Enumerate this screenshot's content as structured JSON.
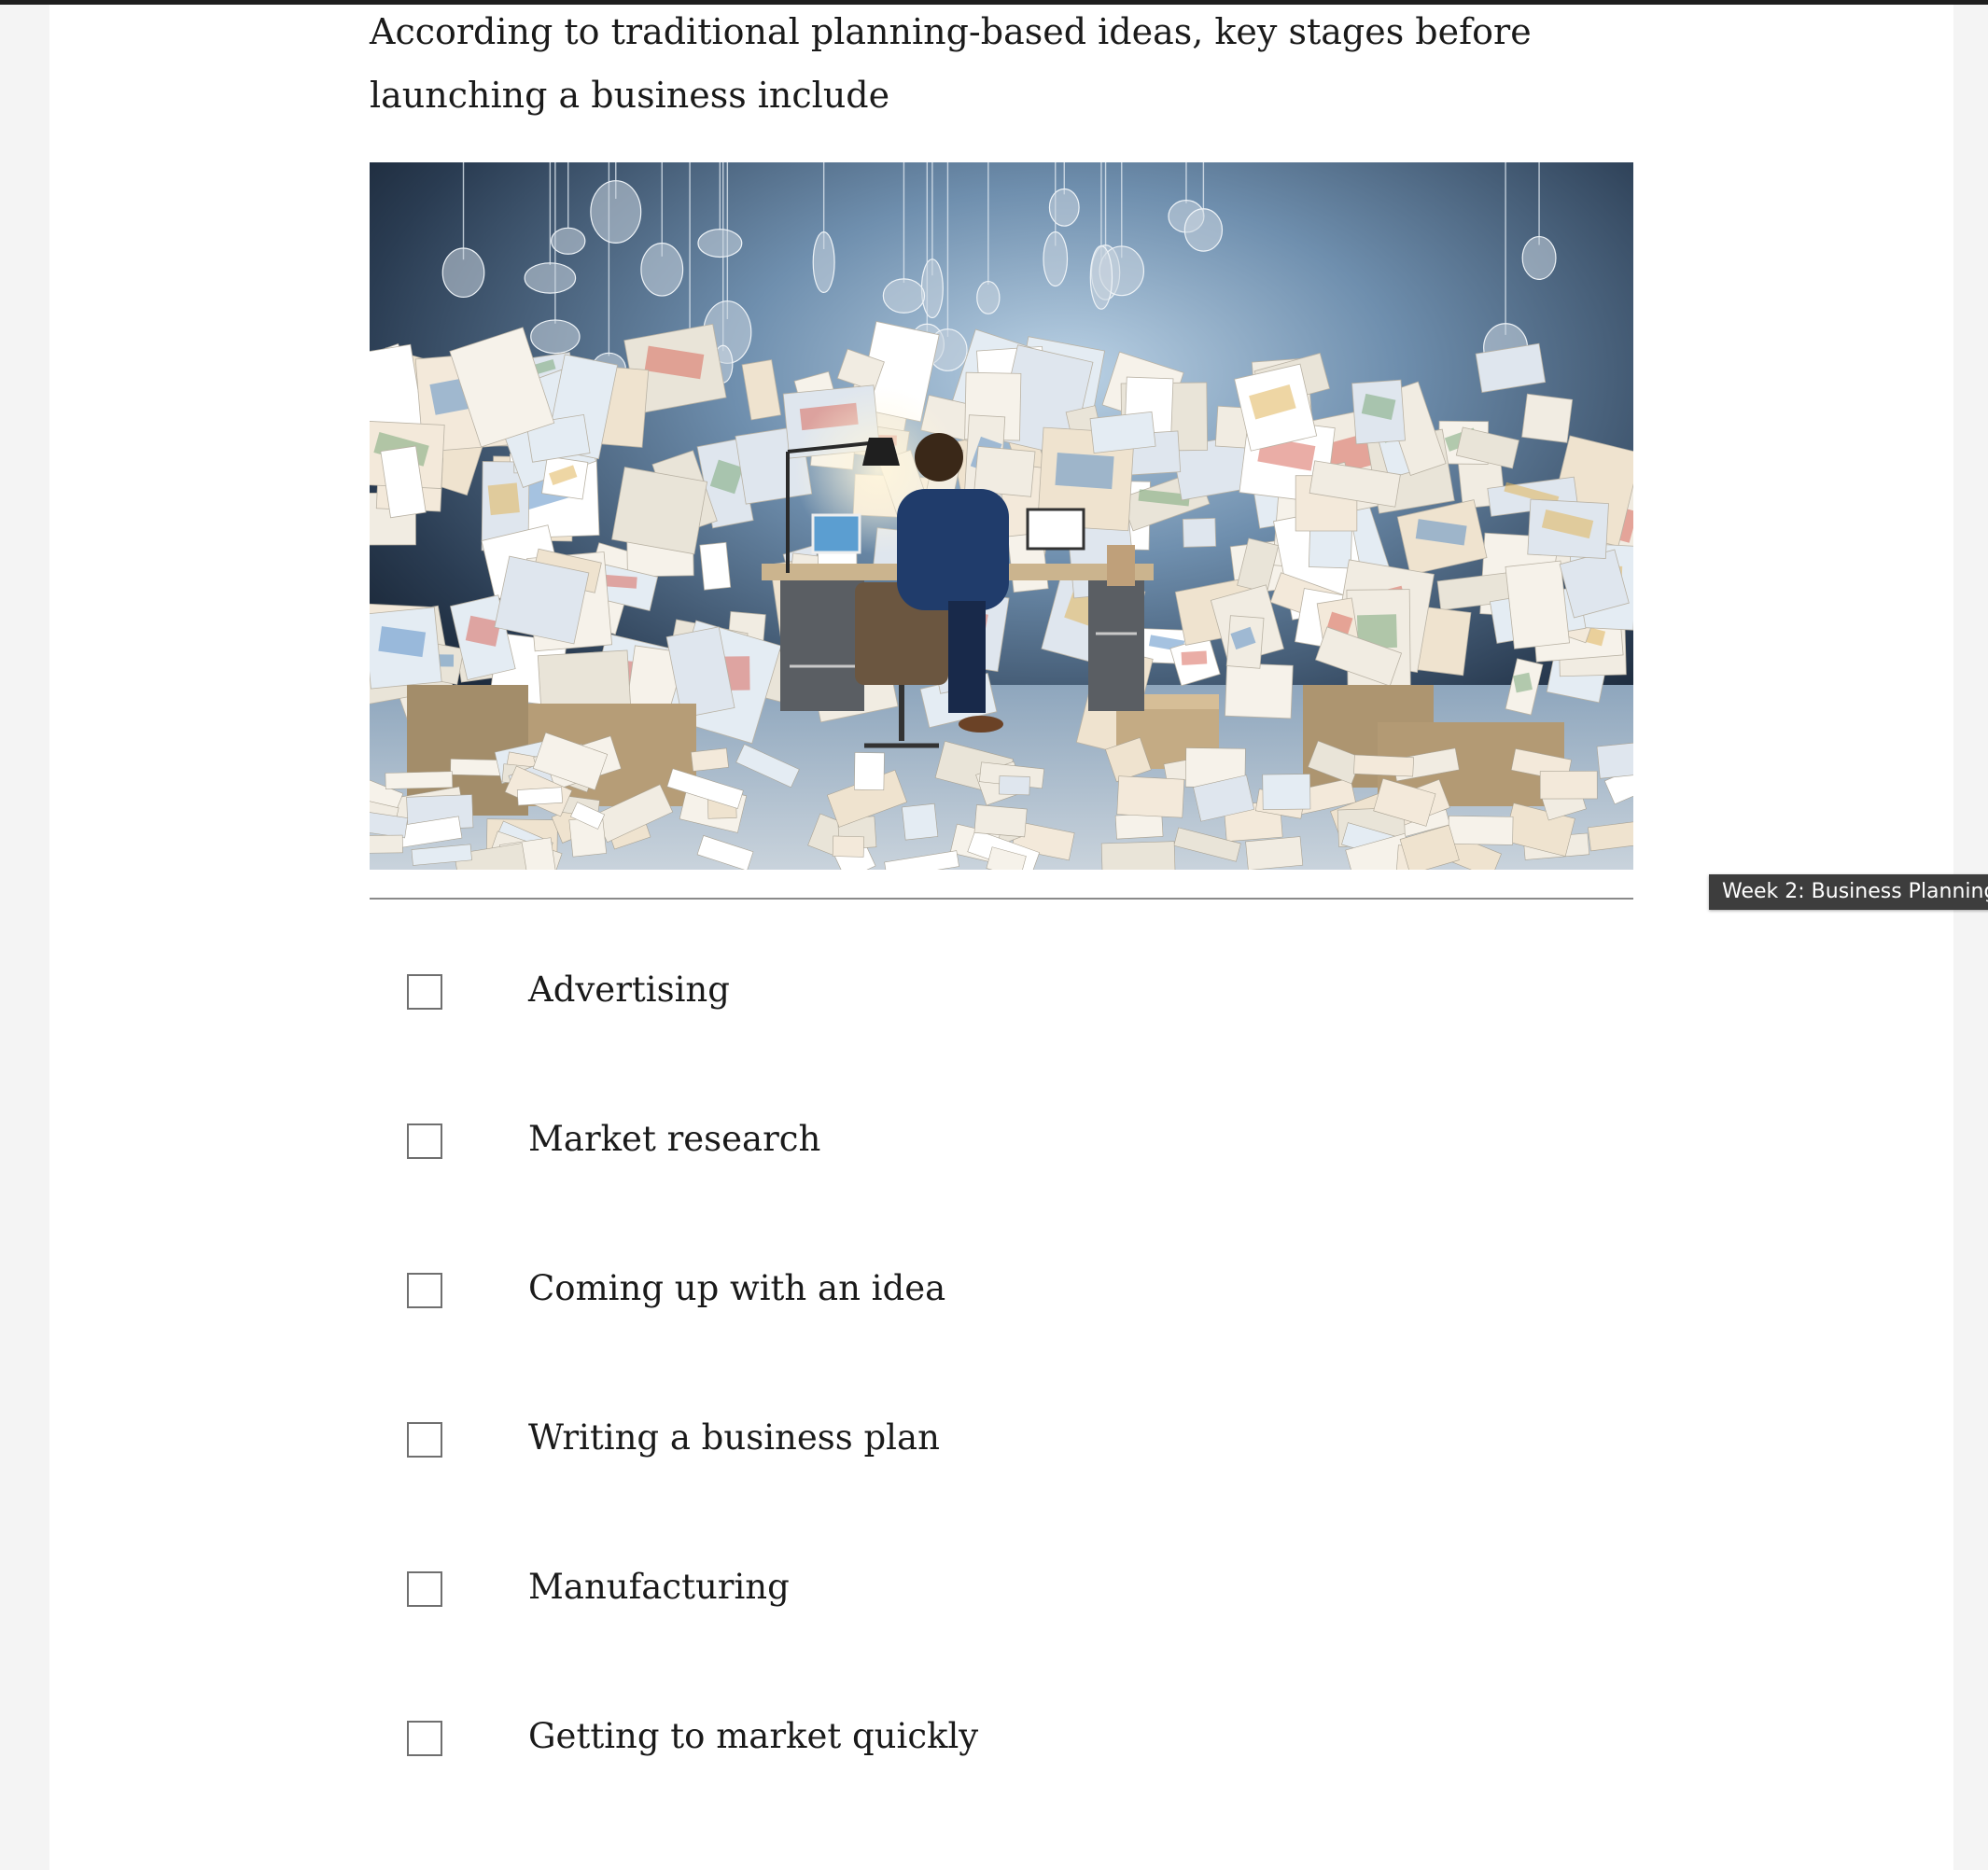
{
  "question": {
    "text": "According to  traditional planning-based ideas, key stages before launching a business include"
  },
  "illustration": {
    "description_icon": "office-paper-chaos-image"
  },
  "options": [
    {
      "label": "Advertising",
      "checked": false
    },
    {
      "label": "Market research",
      "checked": false
    },
    {
      "label": "Coming up with an idea",
      "checked": false
    },
    {
      "label": "Writing a business plan",
      "checked": false
    },
    {
      "label": "Manufacturing",
      "checked": false
    },
    {
      "label": "Getting to market quickly",
      "checked": false
    }
  ],
  "tooltip": {
    "text": "Week 2: Business Planning"
  },
  "colors": {
    "page_background": "#ffffff",
    "outer_background": "#f4f4f4",
    "tooltip_background": "#3d3d3d",
    "checkbox_border": "#6f6f6f"
  }
}
